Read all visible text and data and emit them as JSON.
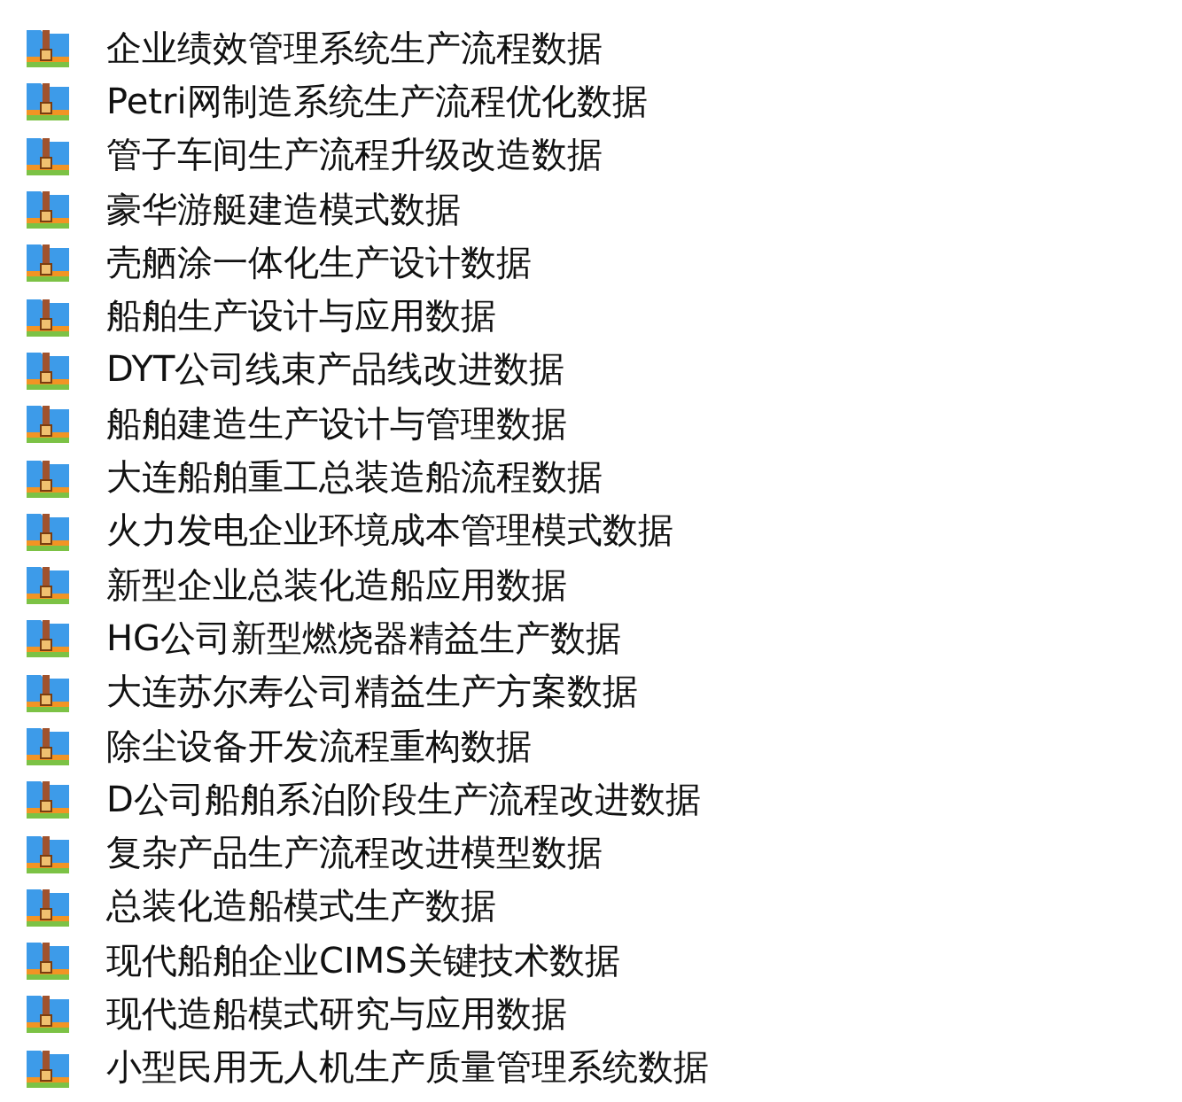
{
  "files": [
    {
      "name": "企业绩效管理系统生产流程数据"
    },
    {
      "name": "Petri网制造系统生产流程优化数据"
    },
    {
      "name": "管子车间生产流程升级改造数据"
    },
    {
      "name": "豪华游艇建造模式数据"
    },
    {
      "name": "壳舾涂一体化生产设计数据"
    },
    {
      "name": "船舶生产设计与应用数据"
    },
    {
      "name": "DYT公司线束产品线改进数据"
    },
    {
      "name": "船舶建造生产设计与管理数据"
    },
    {
      "name": "大连船舶重工总装造船流程数据"
    },
    {
      "name": "火力发电企业环境成本管理模式数据"
    },
    {
      "name": "新型企业总装化造船应用数据"
    },
    {
      "name": "HG公司新型燃烧器精益生产数据"
    },
    {
      "name": "大连苏尔寿公司精益生产方案数据"
    },
    {
      "name": "除尘设备开发流程重构数据"
    },
    {
      "name": "D公司船舶系泊阶段生产流程改进数据"
    },
    {
      "name": "复杂产品生产流程改进模型数据"
    },
    {
      "name": "总装化造船模式生产数据"
    },
    {
      "name": "现代船舶企业CIMS关键技术数据"
    },
    {
      "name": "现代造船模式研究与应用数据"
    },
    {
      "name": "小型民用无人机生产质量管理系统数据"
    }
  ]
}
